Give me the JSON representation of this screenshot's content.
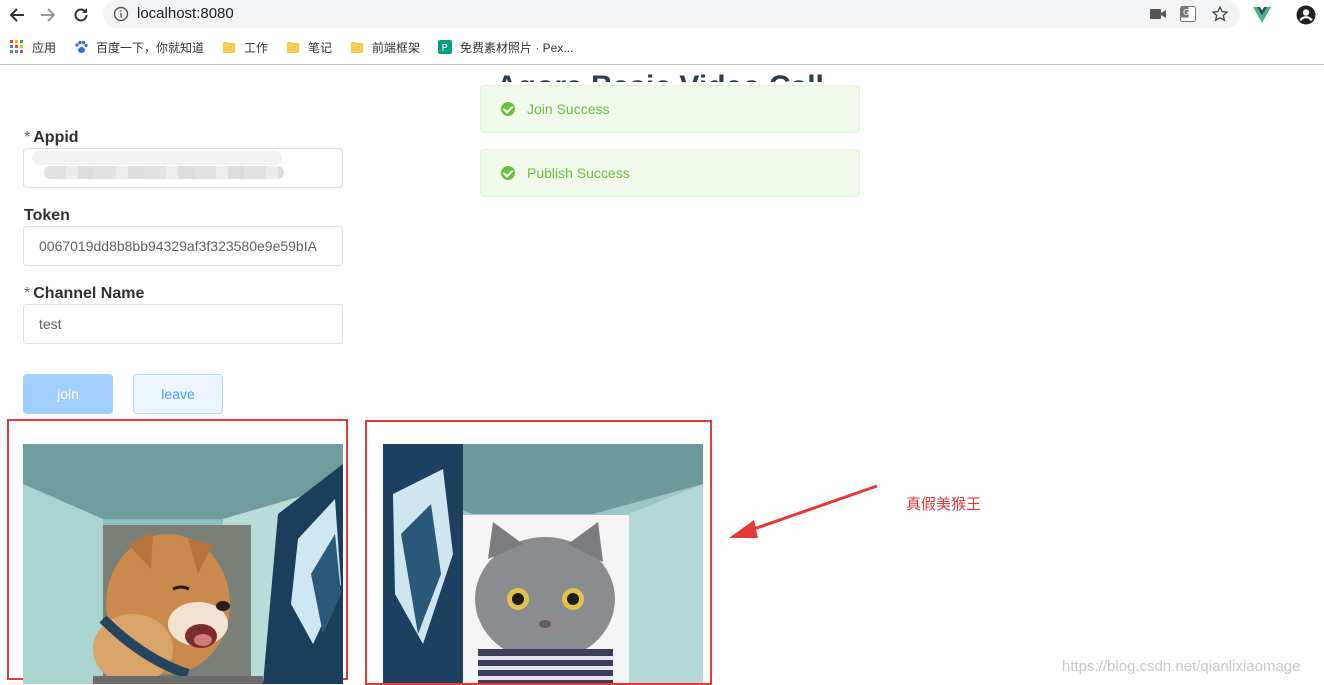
{
  "browser": {
    "url": "localhost:8080",
    "bookmarks": [
      {
        "label": "应用",
        "icon": "apps-grid-icon"
      },
      {
        "label": "百度一下，你就知道",
        "icon": "baidu-paw-icon"
      },
      {
        "label": "工作",
        "icon": "folder-icon"
      },
      {
        "label": "笔记",
        "icon": "folder-icon"
      },
      {
        "label": "前端框架",
        "icon": "folder-icon"
      },
      {
        "label": "免费素材照片 · Pex...",
        "icon": "pexels-icon"
      }
    ]
  },
  "page": {
    "title": "Agora Basic Video Call"
  },
  "alerts": [
    {
      "message": "Join Success",
      "type": "success"
    },
    {
      "message": "Publish Success",
      "type": "success"
    }
  ],
  "form": {
    "appid": {
      "label": "Appid",
      "required": true,
      "value": ""
    },
    "token": {
      "label": "Token",
      "required": false,
      "value": "0067019dd8b8bb94329af3f323580e9e59bIA"
    },
    "channel": {
      "label": "Channel Name",
      "required": true,
      "value": "test"
    }
  },
  "buttons": {
    "join": "join",
    "leave": "leave"
  },
  "annotation": {
    "text": "真假美猴王",
    "color": "#e53935"
  },
  "watermark": "https://blog.csdn.net/qianlixiaomage",
  "colors": {
    "success": "#67c23a",
    "success_bg": "#f0f9eb",
    "primary_light": "#a0cfff",
    "primary": "#409eff",
    "highlight_red": "#e53935"
  }
}
